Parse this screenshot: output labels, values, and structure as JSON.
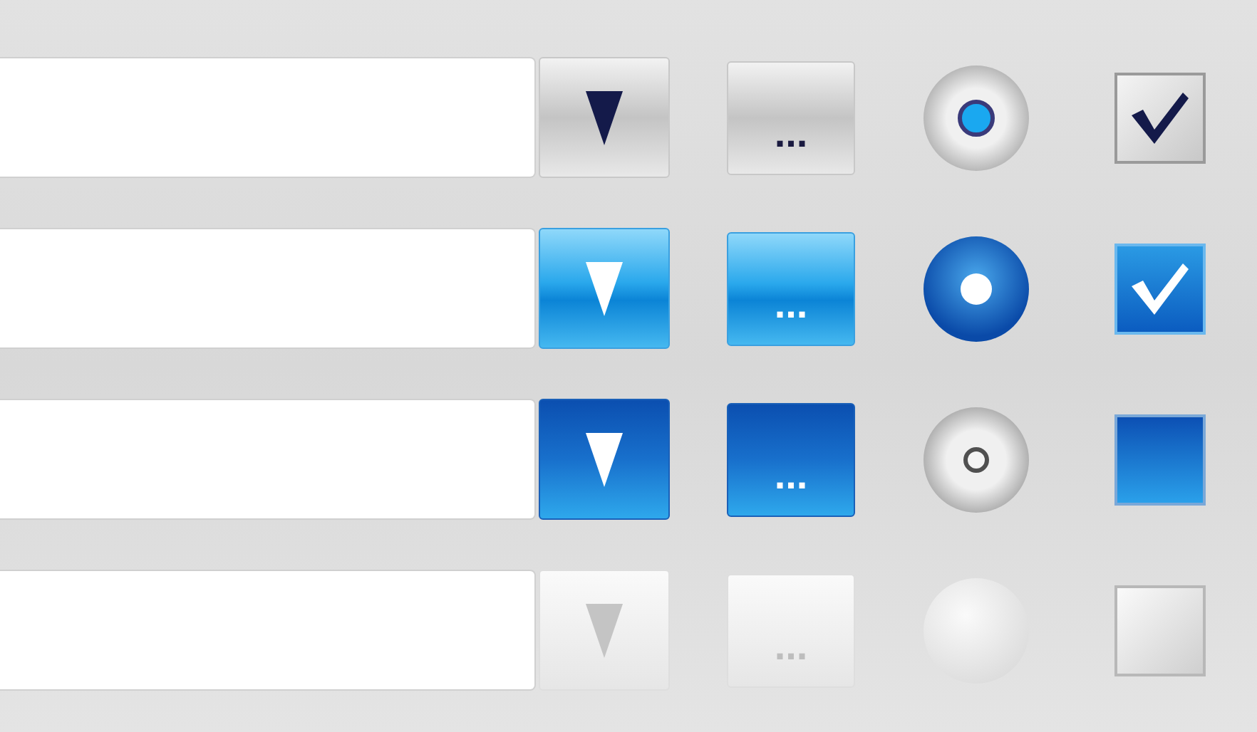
{
  "rows": [
    {
      "kind": "normal",
      "ellipsis": "...",
      "radio_checked": true,
      "checkbox_checked": true
    },
    {
      "kind": "hover",
      "ellipsis": "...",
      "radio_checked": true,
      "checkbox_checked": true
    },
    {
      "kind": "pressed",
      "ellipsis": "...",
      "radio_checked": true,
      "checkbox_checked": false
    },
    {
      "kind": "disabled",
      "ellipsis": "...",
      "radio_checked": false,
      "checkbox_checked": false
    }
  ]
}
